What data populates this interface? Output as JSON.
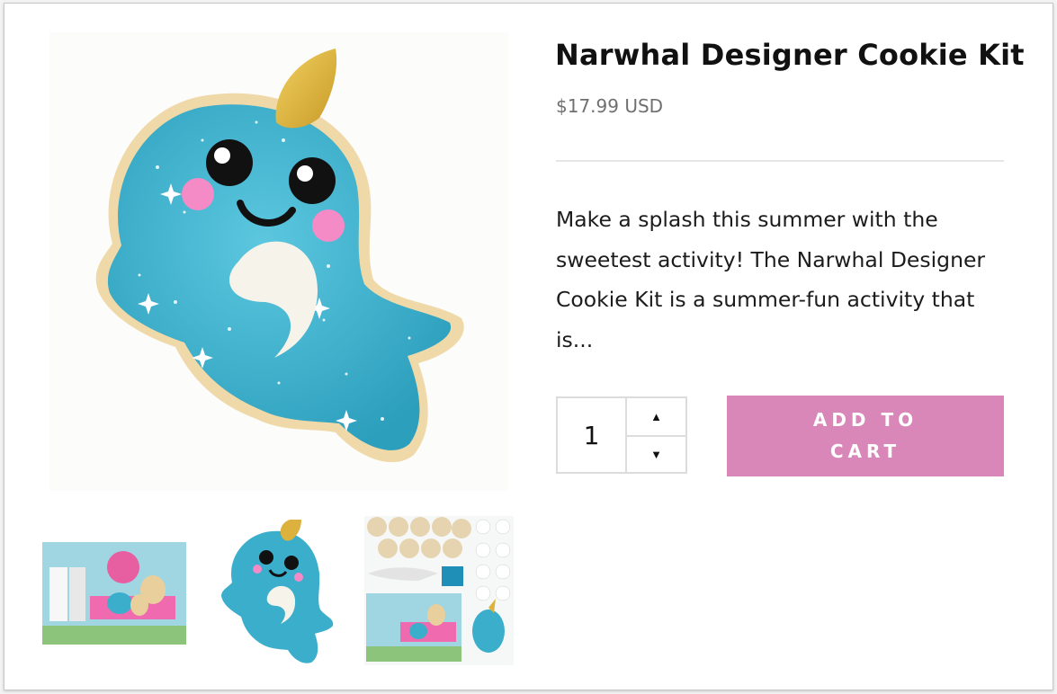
{
  "product": {
    "title": "Narwhal Designer Cookie Kit",
    "price": "$17.99 USD",
    "description": "Make a splash this summer with the sweetest activity! The Narwhal Designer Cookie Kit is a summer-fun activity that is...",
    "quantity": "1",
    "add_to_cart_label": "ADD TO CART"
  },
  "icons": {
    "qty_up": "caret-up-icon",
    "qty_down": "caret-down-icon"
  },
  "colors": {
    "cart_button": "#d887b8",
    "cookie_blue": "#3aaecb",
    "horn_gold": "#dcb13d",
    "text": "#111111",
    "price": "#707070"
  }
}
